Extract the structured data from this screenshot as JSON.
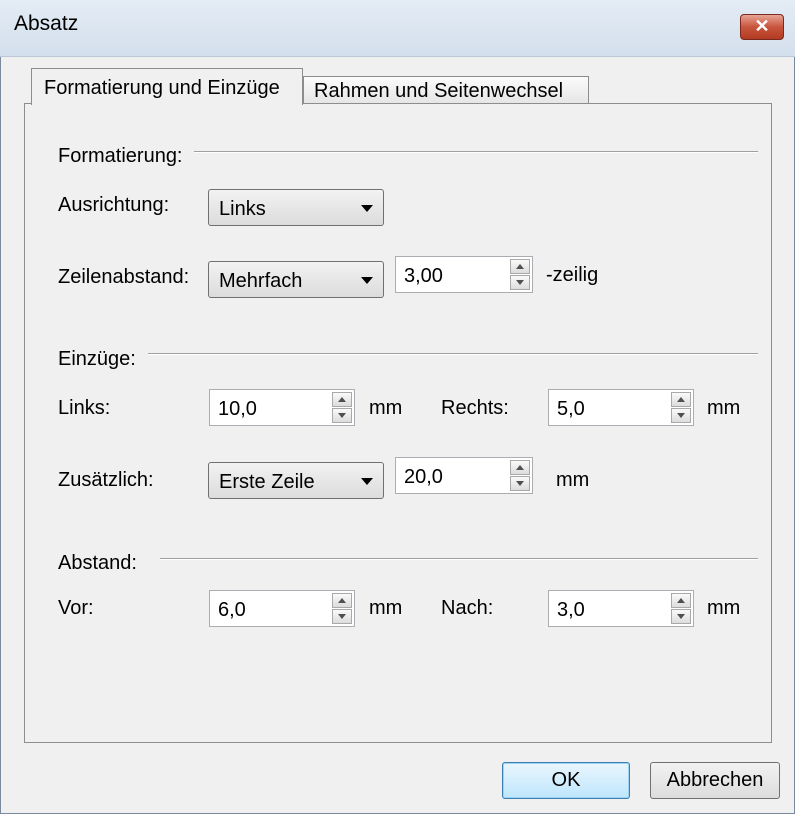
{
  "window": {
    "title": "Absatz",
    "close_icon": "close-icon"
  },
  "tabs": [
    {
      "label": "Formatierung und Einzüge",
      "active": true
    },
    {
      "label": "Rahmen und Seitenwechsel",
      "active": false
    }
  ],
  "formatting": {
    "group_label": "Formatierung:",
    "alignment_label": "Ausrichtung:",
    "alignment_value": "Links",
    "line_spacing_label": "Zeilenabstand:",
    "line_spacing_mode": "Mehrfach",
    "line_spacing_value": "3,00",
    "line_spacing_unit": "-zeilig"
  },
  "indents": {
    "group_label": "Einzüge:",
    "left_label": "Links:",
    "left_value": "10,0",
    "left_unit": "mm",
    "right_label": "Rechts:",
    "right_value": "5,0",
    "right_unit": "mm",
    "special_label": "Zusätzlich:",
    "special_mode": "Erste Zeile",
    "special_value": "20,0",
    "special_unit": "mm"
  },
  "spacing": {
    "group_label": "Abstand:",
    "before_label": "Vor:",
    "before_value": "6,0",
    "before_unit": "mm",
    "after_label": "Nach:",
    "after_value": "3,0",
    "after_unit": "mm"
  },
  "buttons": {
    "ok": "OK",
    "cancel": "Abbrechen"
  },
  "colors": {
    "close_button": "#c8553d",
    "default_button": "#bee6fd"
  }
}
